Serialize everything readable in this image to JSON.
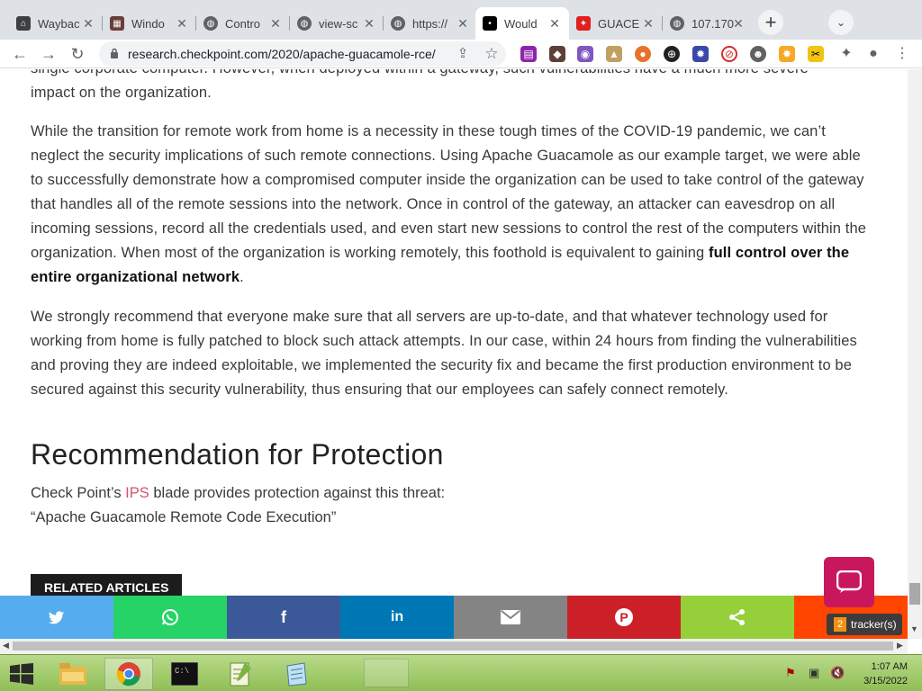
{
  "browser": {
    "tabs": [
      {
        "title": "Waybac",
        "fav_color": "#3c4043",
        "fav_glyph": "☗"
      },
      {
        "title": "Windo",
        "fav_color": "#6a3d3a",
        "fav_glyph": "■"
      },
      {
        "title": "Contro",
        "fav_color": "#5f6368",
        "fav_glyph": "◍"
      },
      {
        "title": "view-sc",
        "fav_color": "#5f6368",
        "fav_glyph": "◍"
      },
      {
        "title": "https://",
        "fav_color": "#5f6368",
        "fav_glyph": "◍"
      },
      {
        "title": "Would",
        "fav_color": "#000000",
        "fav_glyph": "•"
      },
      {
        "title": "GUACE",
        "fav_color": "#e02020",
        "fav_glyph": "✦"
      },
      {
        "title": "107.170",
        "fav_color": "#5f6368",
        "fav_glyph": "◍"
      }
    ],
    "active_tab_index": 5,
    "url": "research.checkpoint.com/2020/apache-guacamole-rce/",
    "extensions": [
      {
        "name": "ext-1",
        "color": "#8e24aa"
      },
      {
        "name": "ext-2",
        "color": "#5d4037"
      },
      {
        "name": "ext-3",
        "color": "#7e57c2"
      },
      {
        "name": "ext-4",
        "color": "#c0a060"
      },
      {
        "name": "ext-5",
        "color": "#e8722c"
      },
      {
        "name": "ext-6",
        "color": "#202124"
      },
      {
        "name": "ext-7",
        "color": "#3949ab"
      },
      {
        "name": "ext-8",
        "color": "#d32f2f"
      },
      {
        "name": "ext-9",
        "color": "#616161"
      },
      {
        "name": "ext-10",
        "color": "#f9a825"
      },
      {
        "name": "ext-11",
        "color": "#f1c40f"
      }
    ]
  },
  "article": {
    "top_fragment": "single corporate computer. However, when deployed within a gateway, such vulnerabilities have a much more severe",
    "top_fragment_2": "impact on the organization.",
    "para1": "While the transition for remote work from home is a necessity in these tough times of the COVID-19 pandemic, we can’t neglect the security implications of such remote connections. Using Apache Guacamole as our example target, we were able to successfully demonstrate how a compromised computer inside the organization can be used to take control of the gateway that handles all of the remote sessions into the network. Once in control of the gateway, an attacker can eavesdrop on all incoming sessions, record all the credentials used, and even start new sessions to control the rest of the computers within the organization. When most of the organization is working remotely, this foothold is equivalent to gaining ",
    "para1_bold": "full control over the entire organizational network",
    "para1_end": ".",
    "para2": "We strongly recommend that everyone make sure that all servers are up-to-date, and that whatever technology used for working from home is fully patched to block such attack attempts. In our case, within 24 hours from finding the vulnerabilities and proving they are indeed exploitable, we implemented the security fix and became the first production environment to be secured against this security vulnerability, thus ensuring that our employees can safely connect remotely.",
    "heading": "Recommendation for Protection",
    "ips_pre": "Check Point’s ",
    "ips_link": "IPS",
    "ips_post": " blade provides protection against this threat:",
    "threat_name": "“Apache Guacamole Remote Code Execution”",
    "related_label": "RELATED ARTICLES"
  },
  "share": [
    {
      "name": "twitter",
      "color": "#55acee",
      "glyph": "🐦"
    },
    {
      "name": "whatsapp",
      "color": "#25d366",
      "glyph": "☎"
    },
    {
      "name": "facebook",
      "color": "#3b5998",
      "glyph": "f"
    },
    {
      "name": "linkedin",
      "color": "#0077b5",
      "glyph": "in"
    },
    {
      "name": "email",
      "color": "#848484",
      "glyph": "✉"
    },
    {
      "name": "pinterest",
      "color": "#cb2027",
      "glyph": "P"
    },
    {
      "name": "sharethis",
      "color": "#95d03a",
      "glyph": "⌥"
    },
    {
      "name": "more",
      "color": "#ff4500",
      "glyph": ""
    }
  ],
  "tracker": {
    "count": "2",
    "label": "tracker(s)"
  },
  "taskbar": {
    "time": "1:07 AM",
    "date": "3/15/2022"
  }
}
